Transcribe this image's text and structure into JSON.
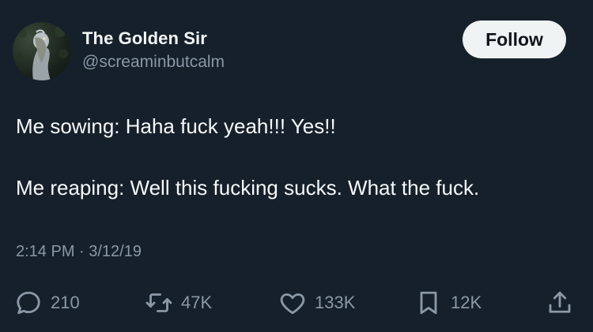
{
  "author": {
    "display_name": "The Golden Sir",
    "handle": "@screaminbutcalm"
  },
  "follow_label": "Follow",
  "tweet": {
    "lines": [
      "Me sowing: Haha fuck yeah!!! Yes!!",
      "Me reaping: Well this fucking sucks. What the fuck."
    ],
    "timestamp": "2:14 PM · 3/12/19"
  },
  "actions": {
    "reply": {
      "icon": "reply-icon",
      "count": "210"
    },
    "retweet": {
      "icon": "retweet-icon",
      "count": "47K"
    },
    "like": {
      "icon": "heart-icon",
      "count": "133K"
    },
    "bookmark": {
      "icon": "bookmark-icon",
      "count": "12K"
    },
    "share": {
      "icon": "share-icon"
    }
  },
  "colors": {
    "background": "#15202b",
    "primary_text": "#f7f9f9",
    "secondary_text": "#8b98a5",
    "follow_button_bg": "#eff3f4"
  }
}
